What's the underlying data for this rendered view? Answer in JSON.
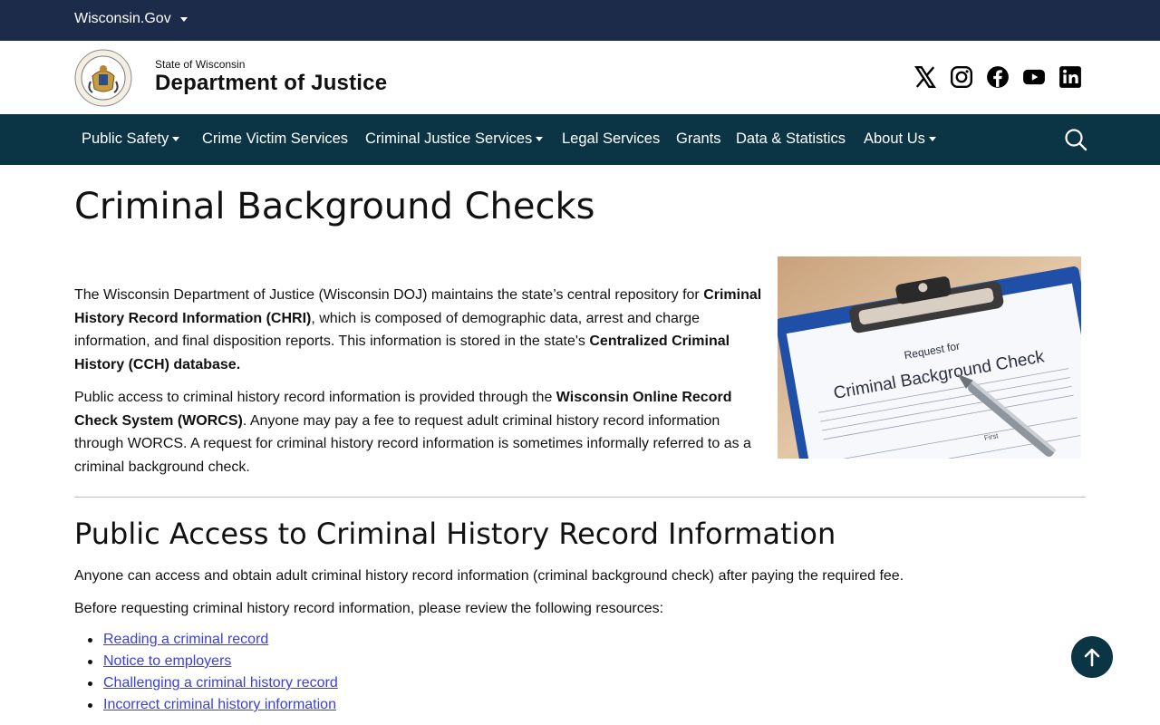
{
  "topbar": {
    "gov_label": "Wisconsin.Gov"
  },
  "header": {
    "state_label": "State of Wisconsin",
    "dept_label": "Department of Justice",
    "social": [
      "x-icon",
      "instagram-icon",
      "facebook-icon",
      "youtube-icon",
      "linkedin-icon"
    ]
  },
  "nav": {
    "items": [
      {
        "label": "Public Safety",
        "dropdown": true
      },
      {
        "label": "Crime Victim Services",
        "dropdown": false
      },
      {
        "label": "Criminal Justice Services",
        "dropdown": true
      },
      {
        "label": "Legal Services",
        "dropdown": false
      },
      {
        "label": "Grants",
        "dropdown": false
      },
      {
        "label": "Data & Statistics",
        "dropdown": false
      },
      {
        "label": "About Us",
        "dropdown": true
      }
    ],
    "search_icon": "search-icon"
  },
  "page": {
    "title": "Criminal Background Checks",
    "intro": {
      "p1_a": "The Wisconsin Department of Justice (Wisconsin DOJ) maintains the state’s central repository for ",
      "p1_b": "Criminal History Record Information (CHRI)",
      "p1_c": ", which is composed of demographic data, arrest and charge information, and final disposition reports. This information is stored in the state's ",
      "p1_d": "Centralized Criminal History (CCH) database.",
      "p2_a": "Public access to criminal history record information is provided through the ",
      "p2_b": "Wisconsin Online Record Check System (WORCS)",
      "p2_c": ". Anyone may pay a fee to request adult criminal history record information through WORCS. A request for criminal history record information is sometimes informally referred to as a criminal background check."
    },
    "image": {
      "doc_heading_small": "Request for",
      "doc_heading_big": "Criminal Background Check",
      "doc_field": "First"
    },
    "section": {
      "heading": "Public Access to Criminal History Record Information",
      "line1": "Anyone can access and obtain adult criminal history record information (criminal background check) after paying the required fee.",
      "line2": "Before requesting criminal history record information, please review the following resources:",
      "links": [
        "Reading a criminal record",
        "Notice to employers",
        "Challenging a criminal history record",
        "Incorrect criminal history information"
      ]
    }
  },
  "colors": {
    "topbar": "#1c2b4a",
    "nav": "#0b3444",
    "link": "#3b3fd6"
  }
}
